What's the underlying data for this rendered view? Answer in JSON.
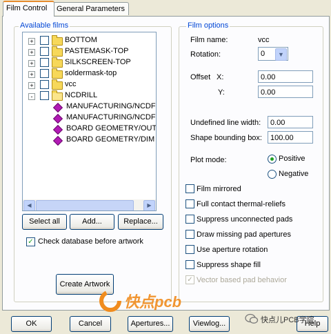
{
  "tabs": [
    {
      "label": "Film Control",
      "active": true
    },
    {
      "label": "General Parameters",
      "active": false
    }
  ],
  "available_films": {
    "title": "Available films",
    "items": [
      {
        "label": "BOTTOM",
        "type": "folder",
        "expander": "+"
      },
      {
        "label": "PASTEMASK-TOP",
        "type": "folder",
        "expander": "+"
      },
      {
        "label": "SILKSCREEN-TOP",
        "type": "folder",
        "expander": "+"
      },
      {
        "label": "soldermask-top",
        "type": "folder",
        "expander": "+"
      },
      {
        "label": "vcc",
        "type": "folder",
        "expander": "+"
      },
      {
        "label": "NCDRILL",
        "type": "folder-open",
        "expander": "-"
      },
      {
        "label": "MANUFACTURING/NCDF",
        "type": "layer"
      },
      {
        "label": "MANUFACTURING/NCDF",
        "type": "layer"
      },
      {
        "label": "BOARD GEOMETRY/OUT",
        "type": "layer"
      },
      {
        "label": "BOARD GEOMETRY/DIM",
        "type": "layer"
      }
    ],
    "buttons": {
      "select_all": "Select all",
      "add": "Add...",
      "replace": "Replace..."
    },
    "check_database": {
      "label": "Check database before artwork",
      "checked": true
    },
    "create_artwork": "Create Artwork"
  },
  "film_options": {
    "title": "Film options",
    "film_name_label": "Film name:",
    "film_name_value": "vcc",
    "rotation_label": "Rotation:",
    "rotation_value": "0",
    "offset_label": "Offset",
    "offset_x_label": "X:",
    "offset_x_value": "0.00",
    "offset_y_label": "Y:",
    "offset_y_value": "0.00",
    "undefined_line_width_label": "Undefined line width:",
    "undefined_line_width_value": "0.00",
    "shape_bounding_box_label": "Shape bounding box:",
    "shape_bounding_box_value": "100.00",
    "plot_mode_label": "Plot mode:",
    "plot_mode_positive": "Positive",
    "plot_mode_negative": "Negative",
    "plot_mode_selected": "Positive",
    "checkboxes": [
      {
        "label": "Film mirrored",
        "checked": false,
        "disabled": false
      },
      {
        "label": "Full contact thermal-reliefs",
        "checked": false,
        "disabled": false
      },
      {
        "label": "Suppress unconnected pads",
        "checked": false,
        "disabled": false
      },
      {
        "label": "Draw missing pad apertures",
        "checked": false,
        "disabled": false
      },
      {
        "label": "Use aperture rotation",
        "checked": false,
        "disabled": false
      },
      {
        "label": "Suppress shape fill",
        "checked": false,
        "disabled": false
      },
      {
        "label": "Vector based pad behavior",
        "checked": true,
        "disabled": true
      }
    ]
  },
  "footer": {
    "ok": "OK",
    "cancel": "Cancel",
    "apertures": "Apertures...",
    "viewlog": "Viewlog...",
    "help": "Help"
  },
  "watermark": {
    "left_text": "快点pcb",
    "right_text": "快点儿PCB学院"
  },
  "colors": {
    "group_title": "#0046d5",
    "active_tab_accent": "#e68b2c",
    "check_mark": "#21a121",
    "watermark_orange": "#f08c1e"
  }
}
